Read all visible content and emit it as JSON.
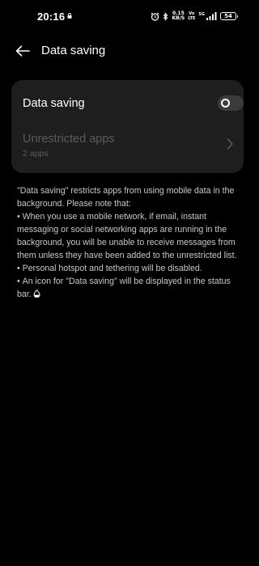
{
  "status_bar": {
    "time": "20:16",
    "speed_value": "0.15",
    "speed_unit": "KB/S",
    "network_top": "Vo",
    "network_bottom": "LTE",
    "signal_tag": "5G",
    "battery": "54",
    "icons": [
      "lock-icon",
      "alarm-icon",
      "bluetooth-icon",
      "signal-icon",
      "battery-icon"
    ]
  },
  "header": {
    "title": "Data saving",
    "back_icon": "back-arrow-icon"
  },
  "settings_card": {
    "data_saving": {
      "label": "Data saving",
      "enabled": false
    },
    "unrestricted_apps": {
      "label": "Unrestricted apps",
      "subtitle": "2 apps",
      "enabled": false
    }
  },
  "description": {
    "intro": "\"Data saving\" restricts apps from using mobile data in the background. Please note that:",
    "bullets": [
      "When you use a mobile network, if email, instant messaging or social networking apps are running in the background, you will be unable to receive messages from them unless they have been added to the unrestricted list.",
      "Personal hotspot and tethering will be disabled.",
      "An icon for \"Data saving\" will be displayed in the status bar."
    ]
  },
  "colors": {
    "background": "#000000",
    "card": "#1e1e1e",
    "primary_text": "#ffffff",
    "disabled_text": "#5b5b5b",
    "body_text": "#c8c8c8",
    "toggle_off": "#3b3b3b"
  }
}
